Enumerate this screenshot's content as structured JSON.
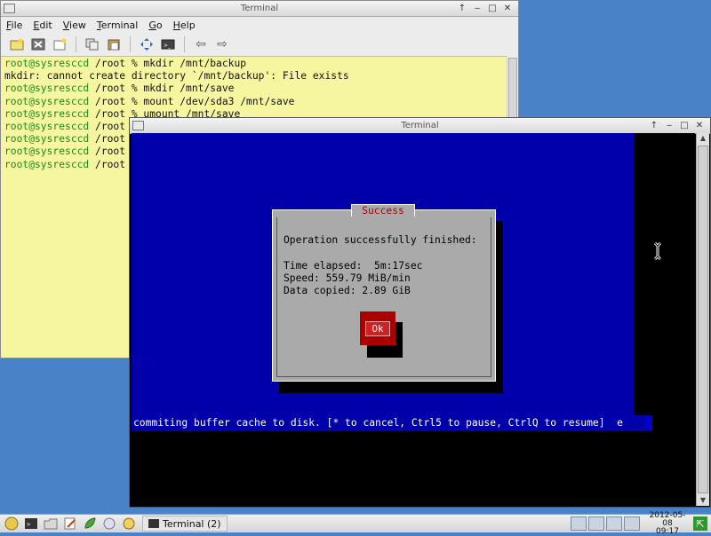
{
  "window1": {
    "title": "Terminal",
    "menu": [
      "File",
      "Edit",
      "View",
      "Terminal",
      "Go",
      "Help"
    ],
    "menu_mnemonic": [
      "F",
      "E",
      "V",
      "T",
      "G",
      "H"
    ],
    "lines": [
      {
        "prompt": "root@sysresccd",
        "text": " /root % mkdir /mnt/backup"
      },
      {
        "prompt": "",
        "text": "mkdir: cannot create directory `/mnt/backup': File exists"
      },
      {
        "prompt": "root@sysresccd",
        "text": " /root % mkdir /mnt/save"
      },
      {
        "prompt": "root@sysresccd",
        "text": " /root % mount /dev/sda3 /mnt/save"
      },
      {
        "prompt": "root@sysresccd",
        "text": " /root % umount /mnt/save"
      },
      {
        "prompt": "root@sysresccd",
        "text": " /root"
      },
      {
        "prompt": "root@sysresccd",
        "text": " /root"
      },
      {
        "prompt": "root@sysresccd",
        "text": " /root"
      },
      {
        "prompt": "root@sysresccd",
        "text": " /root"
      }
    ]
  },
  "window2": {
    "title": "Terminal",
    "dialog": {
      "title": "Success",
      "message": "Operation successfully finished:",
      "time_elapsed": "Time elapsed:  5m:17sec",
      "speed": "Speed: 559.79 MiB/min",
      "data_copied": "Data copied: 2.89 GiB",
      "ok_label": "Ok"
    },
    "status_line": "commiting buffer cache to disk. [* to cancel, Ctrl5 to pause, CtrlQ to resume]  e"
  },
  "taskbar": {
    "task_label": "Terminal (2)",
    "date": "2012-05-08",
    "time": "09:17"
  },
  "colors": {
    "term1_bg": "#f6f6a0",
    "prompt": "#1c8a1c",
    "partimage_blue": "#0000aa",
    "dialog_gray": "#aaaaaa",
    "ok_red": "#aa0000"
  }
}
